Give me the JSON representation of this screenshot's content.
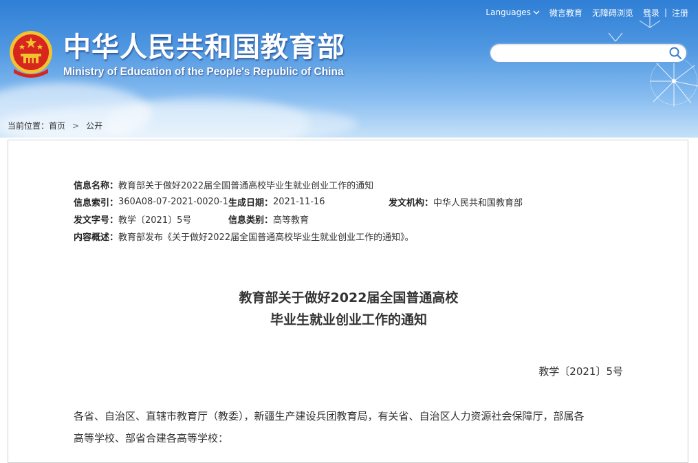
{
  "header": {
    "title": "中华人民共和国教育部",
    "subtitle": "Ministry of Education of the People's Republic of China",
    "nav": {
      "languages": "Languages",
      "wechat": "微言教育",
      "accessibility": "无障碍浏览",
      "login": "登录",
      "separator": "|",
      "register": "注册"
    },
    "search": {
      "value": "",
      "placeholder": ""
    }
  },
  "breadcrumb": {
    "prefix": "当前位置：",
    "items": [
      "首页",
      "公开"
    ],
    "arrow": ">"
  },
  "meta": {
    "name_label": "信息名称：",
    "name_value": "教育部关于做好2022届全国普通高校毕业生就业创业工作的通知",
    "index_label": "信息索引：",
    "index_value": "360A08-07-2021-0020-1",
    "date_label": "生成日期：",
    "date_value": "2021-11-16",
    "org_label": "发文机构：",
    "org_value": "中华人民共和国教育部",
    "docnum_label": "发文字号：",
    "docnum_value": "教学〔2021〕5号",
    "category_label": "信息类别：",
    "category_value": "高等教育",
    "summary_label": "内容概述：",
    "summary_value": "教育部发布《关于做好2022届全国普通高校毕业生就业创业工作的通知》。"
  },
  "article": {
    "title_line1": "教育部关于做好2022届全国普通高校",
    "title_line2": "毕业生就业创业工作的通知",
    "doc_number": "教学〔2021〕5号",
    "body_line1": "各省、自治区、直辖市教育厅（教委），新疆生产建设兵团教育局，有关省、自治区人力资源社会保障厅，部属各",
    "body_line2": "高等学校、部省合建各高等学校："
  },
  "colors": {
    "header_top": "#2f7fd6",
    "header_bottom": "#c6e1f8",
    "emblem_red": "#d7261e",
    "emblem_gold": "#f2c230"
  }
}
